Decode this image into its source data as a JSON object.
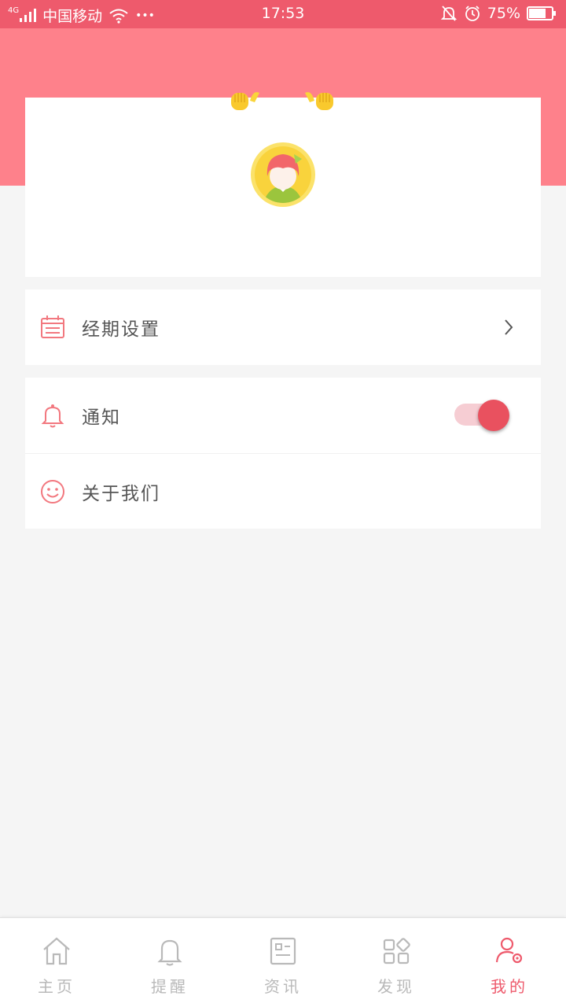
{
  "status_bar": {
    "network": "4G",
    "carrier": "中国移动",
    "more": "•••",
    "time": "17:53",
    "battery": "75%",
    "battery_level": 0.75
  },
  "menu": {
    "period_settings": {
      "label": "经期设置",
      "icon": "calendar-icon"
    },
    "notification": {
      "label": "通知",
      "icon": "bell-icon",
      "enabled": true
    },
    "about_us": {
      "label": "关于我们",
      "icon": "smiley-icon"
    }
  },
  "tabs": [
    {
      "label": "主页",
      "icon": "home-icon",
      "active": false
    },
    {
      "label": "提醒",
      "icon": "bell-icon",
      "active": false
    },
    {
      "label": "资讯",
      "icon": "news-icon",
      "active": false
    },
    {
      "label": "发现",
      "icon": "grid-icon",
      "active": false
    },
    {
      "label": "我的",
      "icon": "user-settings-icon",
      "active": true
    }
  ],
  "colors": {
    "status_bar": "#ee5a6c",
    "header": "#fe818b",
    "accent": "#e9515f",
    "tab_inactive": "#b9b9b9"
  }
}
